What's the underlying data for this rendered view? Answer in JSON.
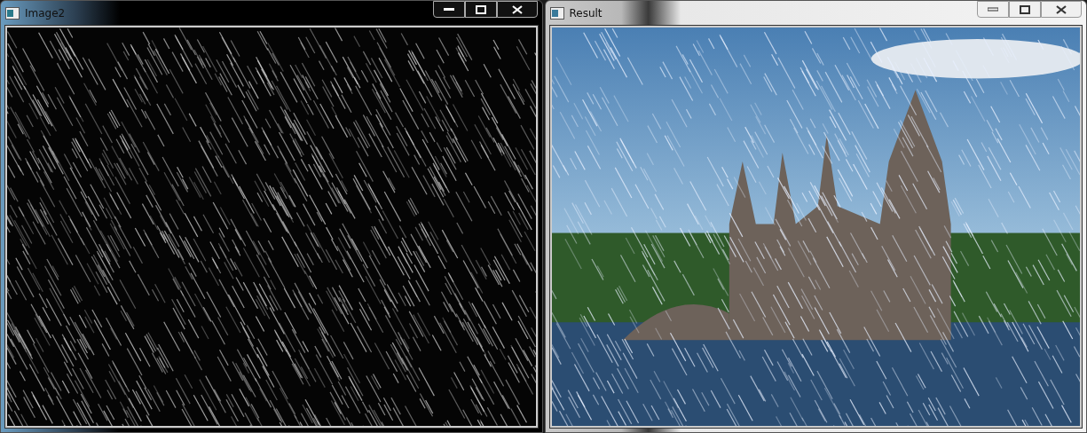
{
  "windows": [
    {
      "title": "Image2",
      "active": true,
      "kind": "rain"
    },
    {
      "title": "Result",
      "active": false,
      "kind": "photo"
    }
  ]
}
